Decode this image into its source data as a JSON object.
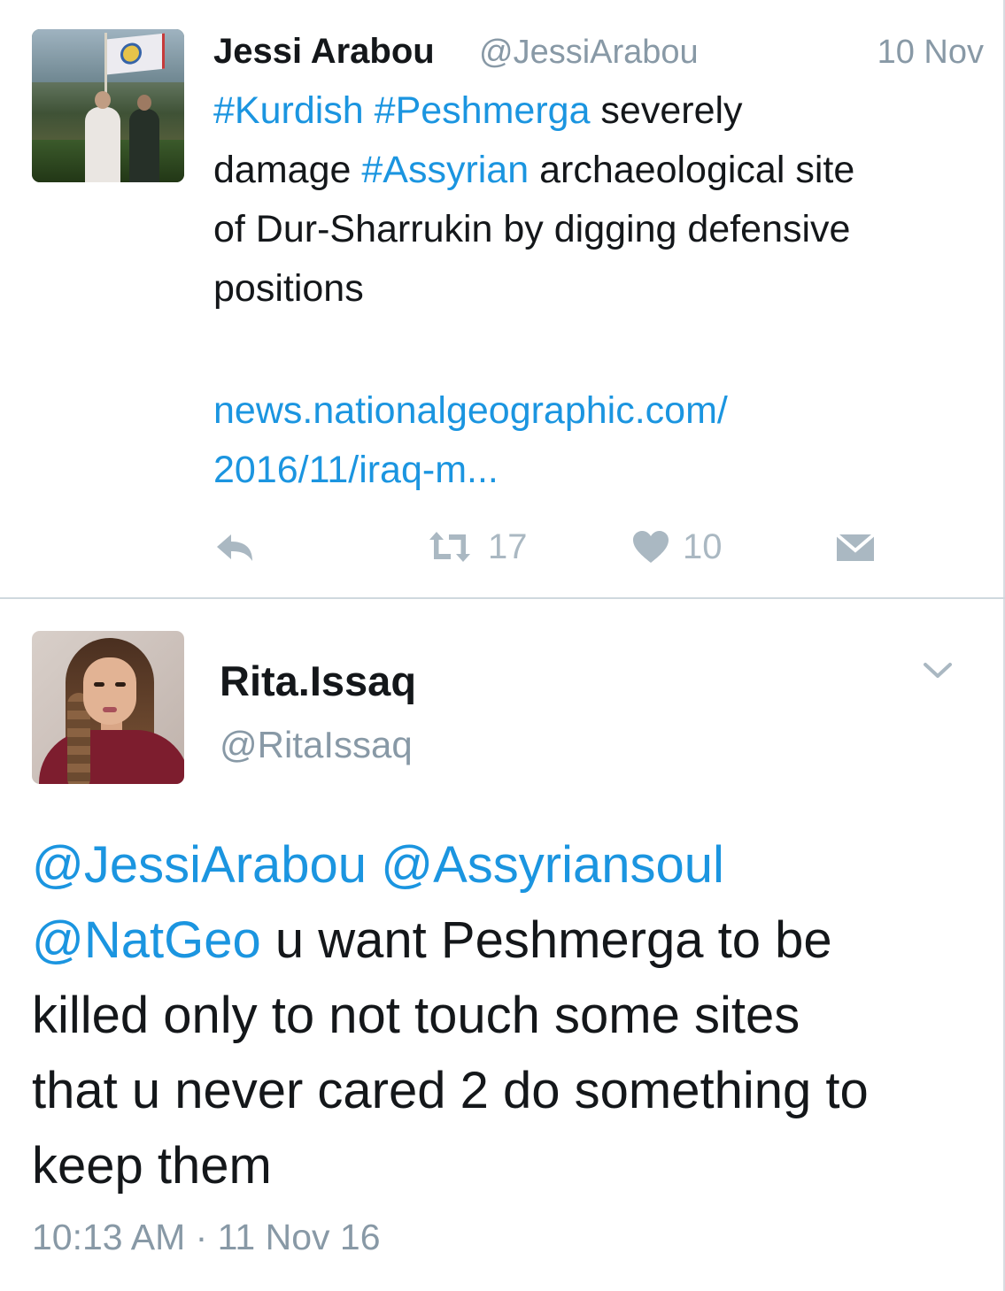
{
  "tweet1": {
    "author_name": "Jessi Arabou",
    "author_handle": "@JessiArabou",
    "date": "10 Nov",
    "avatar_icon": "profile-photo-flag-rally",
    "body": {
      "line1": {
        "tag1": "#Kurdish",
        "tag2": "#Peshmerga",
        "text": " severely"
      },
      "line2": {
        "text_before": "damage ",
        "tag": "#Assyrian",
        "text_after": " archaeological site"
      },
      "line3": "of Dur-Sharrukin by digging defensive",
      "line4": "positions"
    },
    "link": {
      "line1": "news.nationalgeographic.com/",
      "line2": "2016/11/iraq-m..."
    },
    "actions": {
      "reply_icon": "reply-icon",
      "retweet_icon": "retweet-icon",
      "retweet_count": "17",
      "like_icon": "heart-icon",
      "like_count": "10",
      "dm_icon": "envelope-icon"
    }
  },
  "tweet2": {
    "author_name": "Rita.Issaq",
    "author_handle": "@RitaIssaq",
    "avatar_icon": "profile-photo-woman",
    "menu_icon": "chevron-down-icon",
    "body": {
      "line1": {
        "mention1": "@JessiArabou",
        "mention2": "@Assyriansoul"
      },
      "line2": {
        "mention": "@NatGeo",
        "text": " u want Peshmerga to be"
      },
      "line3": "killed only to not touch some sites",
      "line4": "that u never cared 2 do something to",
      "line5": "keep them"
    },
    "timestamp": "10:13 AM · 11 Nov 16"
  },
  "colors": {
    "link": "#1b95e0",
    "text": "#14171a",
    "muted": "#8899a6",
    "action_icon": "#aab8c2",
    "divider": "#cfd8de"
  }
}
